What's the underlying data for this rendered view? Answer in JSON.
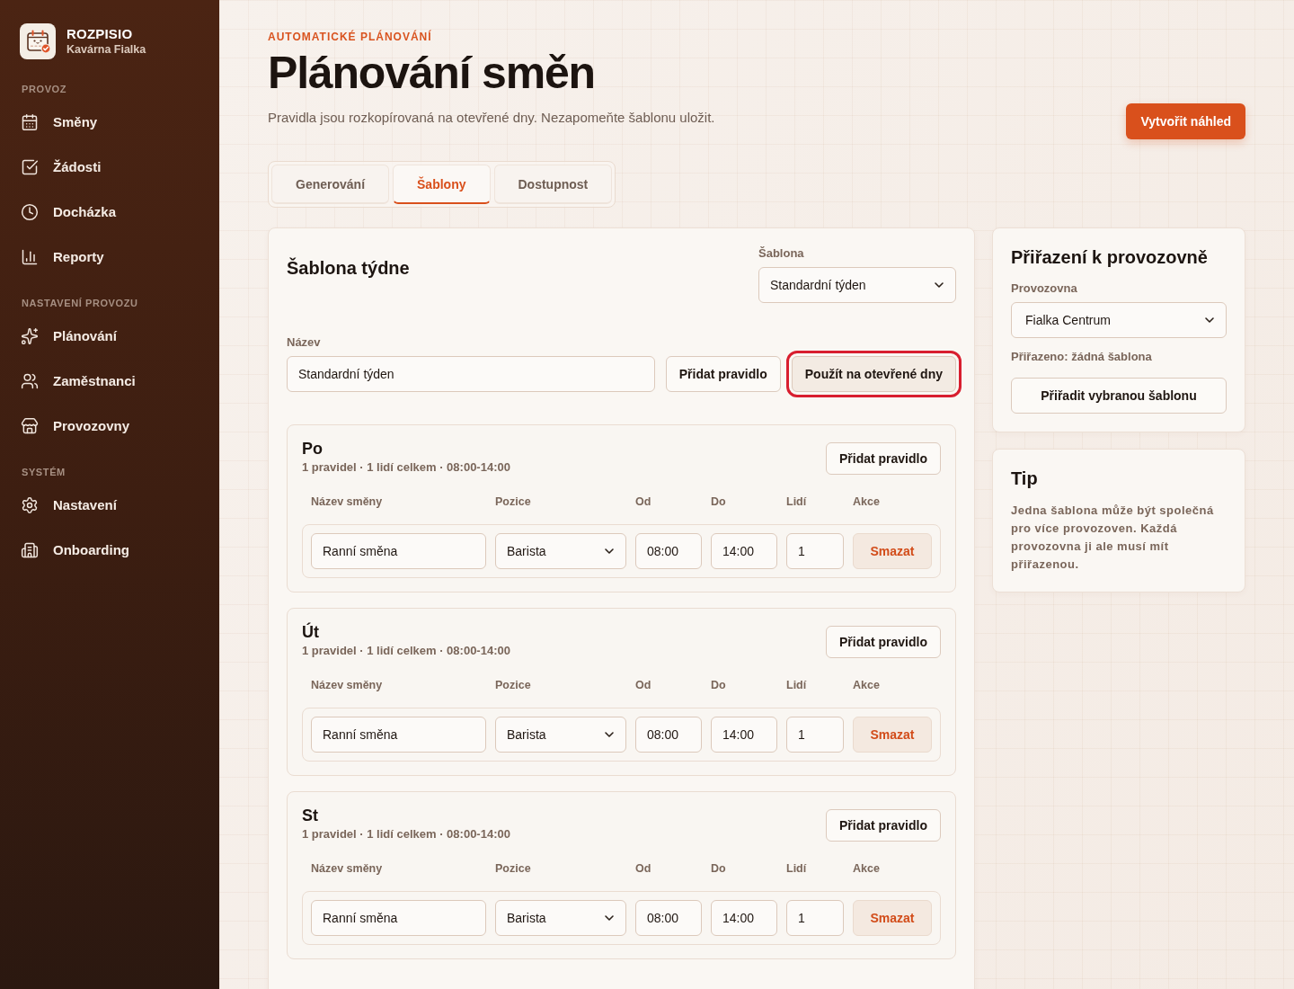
{
  "sidebar": {
    "brand": {
      "name": "ROZPISIO",
      "subtitle": "Kavárna Fialka"
    },
    "sections": [
      {
        "title": "PROVOZ",
        "items": [
          "Směny",
          "Žádosti",
          "Docházka",
          "Reporty"
        ]
      },
      {
        "title": "NASTAVENÍ PROVOZU",
        "items": [
          "Plánování",
          "Zaměstnanci",
          "Provozovny"
        ]
      },
      {
        "title": "SYSTÉM",
        "items": [
          "Nastavení",
          "Onboarding"
        ]
      }
    ]
  },
  "header": {
    "eyebrow": "AUTOMATICKÉ PLÁNOVÁNÍ",
    "title": "Plánování směn",
    "subtitle": "Pravidla jsou rozkopírovaná na otevřené dny. Nezapomeňte šablonu uložit.",
    "primary_button": "Vytvořit náhled"
  },
  "tabs": [
    {
      "label": "Generování",
      "selected": false
    },
    {
      "label": "Šablony",
      "selected": true
    },
    {
      "label": "Dostupnost",
      "selected": false
    }
  ],
  "template_card": {
    "title": "Šablona týdne",
    "template_select": {
      "label": "Šablona",
      "value": "Standardní týden"
    },
    "name_field": {
      "label": "Název",
      "value": "Standardní týden"
    },
    "buttons": [
      {
        "label": "Přidat pravidlo",
        "highlighted": false
      },
      {
        "label": "Použít na otevřené dny",
        "highlighted": true
      }
    ],
    "days": [
      {
        "name": "Po",
        "summary": "1 pravidel · 1 lidí celkem · 08:00-14:00",
        "add_button": "Přidat pravidlo",
        "columns": [
          "Název směny",
          "Pozice",
          "Od",
          "Do",
          "Lidí",
          "Akce"
        ],
        "rules": [
          {
            "name": "Ranní směna",
            "position": "Barista",
            "from": "08:00",
            "to": "14:00",
            "people": "1",
            "delete_button": "Smazat"
          }
        ]
      },
      {
        "name": "Út",
        "summary": "1 pravidel · 1 lidí celkem · 08:00-14:00",
        "add_button": "Přidat pravidlo",
        "columns": [
          "Název směny",
          "Pozice",
          "Od",
          "Do",
          "Lidí",
          "Akce"
        ],
        "rules": [
          {
            "name": "Ranní směna",
            "position": "Barista",
            "from": "08:00",
            "to": "14:00",
            "people": "1",
            "delete_button": "Smazat"
          }
        ]
      },
      {
        "name": "St",
        "summary": "1 pravidel · 1 lidí celkem · 08:00-14:00",
        "add_button": "Přidat pravidlo",
        "columns": [
          "Název směny",
          "Pozice",
          "Od",
          "Do",
          "Lidí",
          "Akce"
        ],
        "rules": [
          {
            "name": "Ranní směna",
            "position": "Barista",
            "from": "08:00",
            "to": "14:00",
            "people": "1",
            "delete_button": "Smazat"
          }
        ]
      }
    ]
  },
  "assignment_card": {
    "title": "Přiřazení k provozovně",
    "venue_select": {
      "label": "Provozovna",
      "value": "Fialka Centrum"
    },
    "assigned_text": "Přiřazeno: žádná šablona",
    "assign_button": "Přiřadit vybranou šablonu"
  },
  "tip_card": {
    "title": "Tip",
    "text": "Jedna šablona může být společná pro více provozoven. Každá provozovna ji ale musí mít přiřazenou."
  }
}
